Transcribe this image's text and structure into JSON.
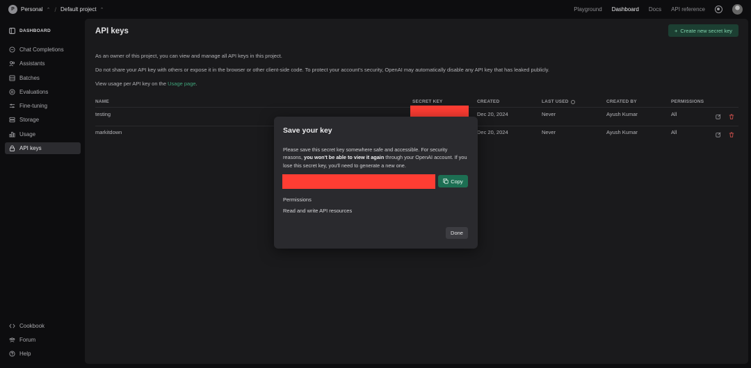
{
  "topbar": {
    "org_initial": "P",
    "org_name": "Personal",
    "project_name": "Default project",
    "nav": [
      "Playground",
      "Dashboard",
      "Docs",
      "API reference"
    ]
  },
  "sidebar": {
    "header": "DASHBOARD",
    "items": [
      {
        "label": "Chat Completions",
        "icon": "chat-icon"
      },
      {
        "label": "Assistants",
        "icon": "assistants-icon"
      },
      {
        "label": "Batches",
        "icon": "batches-icon"
      },
      {
        "label": "Evaluations",
        "icon": "evaluations-icon"
      },
      {
        "label": "Fine-tuning",
        "icon": "fine-tuning-icon"
      },
      {
        "label": "Storage",
        "icon": "storage-icon"
      },
      {
        "label": "Usage",
        "icon": "usage-icon"
      },
      {
        "label": "API keys",
        "icon": "lock-icon"
      }
    ],
    "footer": [
      {
        "label": "Cookbook",
        "icon": "code-icon"
      },
      {
        "label": "Forum",
        "icon": "forum-icon"
      },
      {
        "label": "Help",
        "icon": "help-icon"
      }
    ]
  },
  "main": {
    "title": "API keys",
    "create_button": "Create new secret key",
    "para1": "As an owner of this project, you can view and manage all API keys in this project.",
    "para2": "Do not share your API key with others or expose it in the browser or other client-side code. To protect your account's security, OpenAI may automatically disable any API key that has leaked publicly.",
    "para3_prefix": "View usage per API key on the ",
    "para3_link": "Usage page",
    "para3_suffix": ".",
    "columns": [
      "NAME",
      "SECRET KEY",
      "CREATED",
      "LAST USED",
      "CREATED BY",
      "PERMISSIONS"
    ],
    "rows": [
      {
        "name": "testing",
        "created": "Dec 20, 2024",
        "last_used": "Never",
        "created_by": "Ayush Kumar",
        "permissions": "All"
      },
      {
        "name": "markitdown",
        "created": "Dec 20, 2024",
        "last_used": "Never",
        "created_by": "Ayush Kumar",
        "permissions": "All"
      }
    ]
  },
  "modal": {
    "title": "Save your key",
    "text_prefix": "Please save this secret key somewhere safe and accessible. For security reasons, ",
    "text_bold": "you won't be able to view it again",
    "text_suffix": " through your OpenAI account. If you lose this secret key, you'll need to generate a new one.",
    "copy_button": "Copy",
    "permissions_label": "Permissions",
    "permissions_value": "Read and write API resources",
    "done_button": "Done"
  },
  "colors": {
    "accent_green": "#1d6f53",
    "redaction": "#ff3d33",
    "panel": "#1a1a1c"
  }
}
